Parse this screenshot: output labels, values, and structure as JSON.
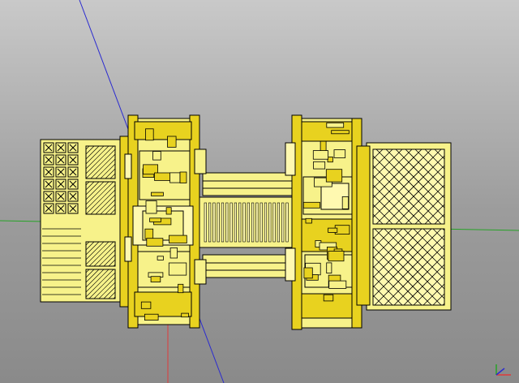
{
  "viewer": {
    "background_top": "#c9c9c9",
    "background_bottom": "#8a8a8a",
    "axis_colors": {
      "x": "#e03a3a",
      "y": "#27a327",
      "z": "#2b2bd0"
    },
    "model_color": "#f7f28a",
    "model_shade": "#e8d21f",
    "model_dark": "#c9a800",
    "edge_color": "#000000",
    "triad_icon": "axis-triad-icon"
  }
}
